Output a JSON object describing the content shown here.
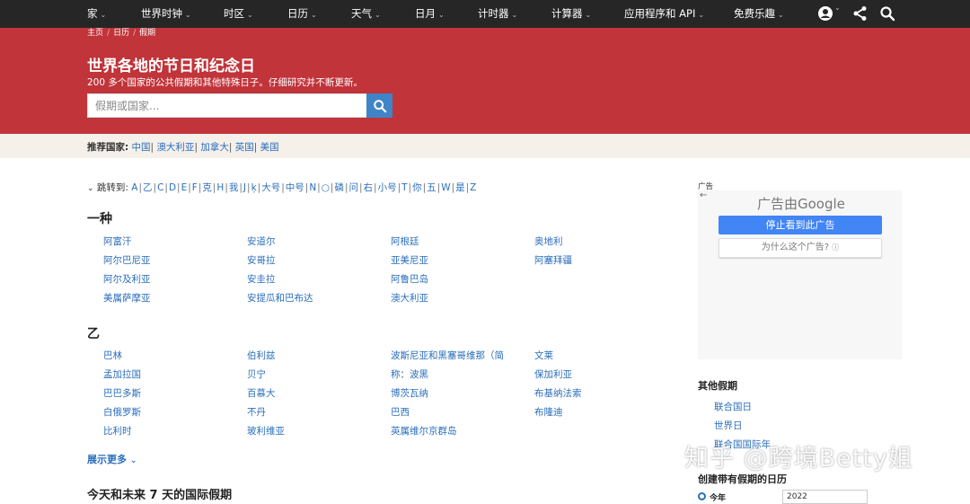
{
  "nav": {
    "items": [
      "家",
      "世界时钟",
      "时区",
      "日历",
      "天气",
      "日月",
      "计时器",
      "计算器",
      "应用程序和 API",
      "免费乐趣"
    ]
  },
  "breadcrumb": [
    "主页",
    "日历",
    "假期"
  ],
  "hero": {
    "title": "世界各地的节日和纪念日",
    "subtitle": "200 多个国家的公共假期和其他特殊日子。仔细研究并不断更新。",
    "search_placeholder": "假期或国家..."
  },
  "recommended": {
    "label": "推荐国家:",
    "countries": [
      "中国",
      "澳大利亚",
      "加拿大",
      "英国",
      "美国"
    ]
  },
  "jump": {
    "label": "跳转到:",
    "letters": [
      "A",
      "乙",
      "C",
      "D",
      "E",
      "F",
      "克",
      "H",
      "我",
      "J",
      "ķ",
      "大号",
      "中号",
      "N",
      "○",
      "磷",
      "问",
      "右",
      "小号",
      "T",
      "你",
      "五",
      "W",
      "是",
      "Z"
    ]
  },
  "sections": [
    {
      "heading": "一种",
      "columns": [
        [
          "阿富汗",
          "阿尔巴尼亚",
          "阿尔及利亚",
          "美属萨摩亚"
        ],
        [
          "安道尔",
          "安哥拉",
          "安圭拉",
          "安提瓜和巴布达"
        ],
        [
          "阿根廷",
          "亚美尼亚",
          "阿鲁巴岛",
          "澳大利亚"
        ],
        [
          "奥地利",
          "阿塞拜疆"
        ]
      ]
    },
    {
      "heading": "乙",
      "columns": [
        [
          "巴林",
          "孟加拉国",
          "巴巴多斯",
          "白俄罗斯",
          "比利时"
        ],
        [
          "伯利兹",
          "贝宁",
          "百慕大",
          "不丹",
          "玻利维亚"
        ],
        [
          "波斯尼亚和黑塞哥维那（简",
          "称：波黑",
          "博茨瓦纳",
          "巴西",
          "英属维尔京群岛"
        ],
        [
          "文莱",
          "保加利亚",
          "布基纳法索",
          "布隆迪"
        ]
      ]
    }
  ],
  "show_more": "展示更多",
  "today_heading": "今天和未来 7 天的国际假期",
  "ad": {
    "label": "广告",
    "by_google": "广告由Google",
    "stop_button": "停止看到此广告",
    "why_button": "为什么这个广告?"
  },
  "sidebar": {
    "other_heading": "其他假期",
    "other_links": [
      "联合国日",
      "世界日",
      "联合国国际年"
    ],
    "calendar_heading": "创建带有假期的日历",
    "radio_label": "今年",
    "year_value": "2022"
  },
  "watermark": "知乎 @跨境Betty姐",
  "colors": {
    "nav_bg": "#262626",
    "hero_bg": "#c0343a",
    "search_btn": "#3f84c6",
    "link": "#2a6ebb"
  }
}
